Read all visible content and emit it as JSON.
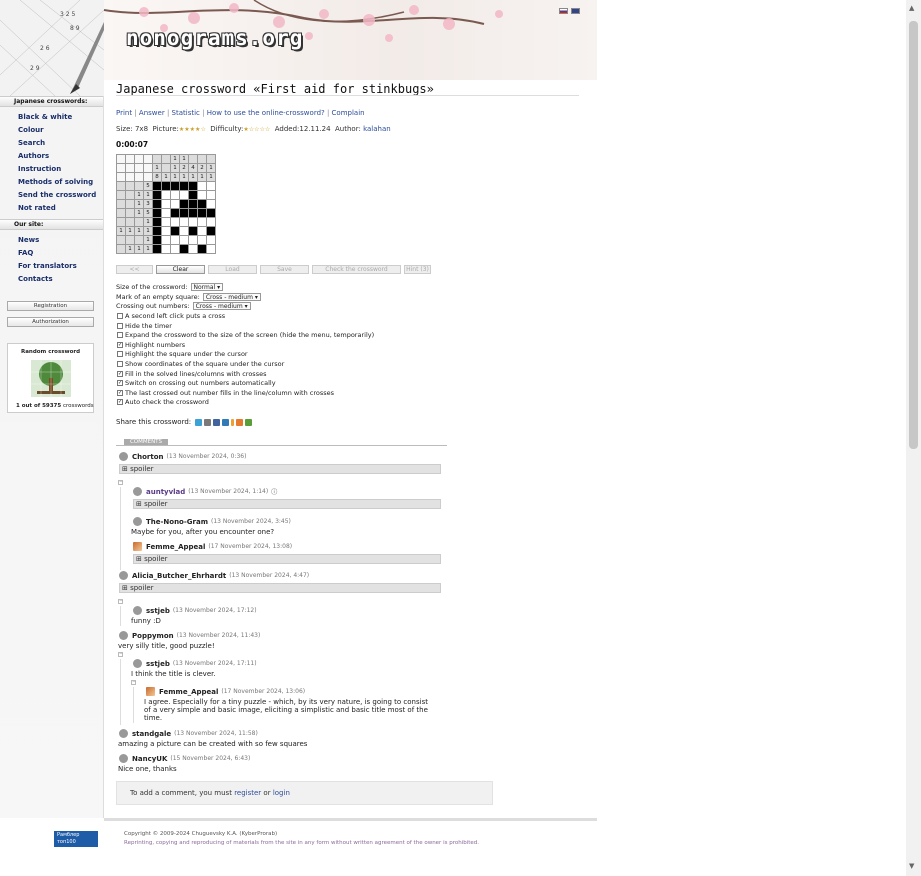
{
  "site": {
    "logo": "nonograms.org"
  },
  "sidebar": {
    "section1": "Japanese crosswords:",
    "items1": [
      "Black & white",
      "Colour",
      "Search",
      "Authors",
      "Instruction",
      "Methods of solving",
      "Send the crossword",
      "Not rated"
    ],
    "section2": "Our site:",
    "items2": [
      "News",
      "FAQ",
      "For translators",
      "Contacts"
    ],
    "registration": "Registration",
    "authorization": "Authorization",
    "random_title": "Random crossword",
    "random_count_a": "1 out of 59375",
    "random_count_b": "crosswords"
  },
  "puzzle": {
    "title": "Japanese crossword «First aid for stinkbugs»",
    "links": [
      "Print",
      "Answer",
      "Statistic",
      "How to use the online-crossword?",
      "Complain"
    ],
    "size_label": "Size:",
    "size": "7x8",
    "picture_label": "Picture:",
    "picture_stars": "★★★★☆",
    "difficulty_label": "Difficulty:",
    "difficulty_stars": "★☆☆☆☆",
    "added_label": "Added:",
    "added": "12.11.24",
    "author_label": "Author:",
    "author": "kalahan",
    "timer": "0:00:07",
    "col_clues": [
      [
        "",
        "1",
        "8"
      ],
      [
        "",
        "",
        "1"
      ],
      [
        "1",
        "1",
        "1"
      ],
      [
        "1",
        "2",
        "1"
      ],
      [
        "",
        "4",
        "1"
      ],
      [
        "",
        "2",
        "1"
      ],
      [
        "",
        "1",
        "1"
      ]
    ],
    "row_clues": [
      [
        "",
        "",
        "",
        "5"
      ],
      [
        "",
        "",
        "1",
        "1"
      ],
      [
        "",
        "",
        "1",
        "3"
      ],
      [
        "",
        "",
        "1",
        "5"
      ],
      [
        "",
        "",
        "",
        "1"
      ],
      [
        "1",
        "1",
        "1",
        "1"
      ],
      [
        "",
        "",
        "",
        "1"
      ],
      [
        "",
        "1",
        "1",
        "1"
      ]
    ],
    "cells": [
      [
        1,
        1,
        1,
        1,
        1,
        0,
        0
      ],
      [
        1,
        0,
        0,
        0,
        1,
        0,
        0
      ],
      [
        1,
        0,
        0,
        1,
        1,
        1,
        0
      ],
      [
        1,
        0,
        1,
        1,
        1,
        1,
        1
      ],
      [
        1,
        0,
        0,
        0,
        0,
        0,
        0
      ],
      [
        1,
        0,
        1,
        0,
        1,
        0,
        1
      ],
      [
        1,
        0,
        0,
        0,
        0,
        0,
        0
      ],
      [
        1,
        0,
        0,
        1,
        0,
        1,
        0
      ]
    ]
  },
  "buttons": {
    "undo": "<<",
    "clear": "Clear",
    "load": "Load",
    "save": "Save",
    "check": "Check the crossword",
    "hint": "Hint (3)"
  },
  "options": {
    "size_label": "Size of the crossword:",
    "size_value": "Normal",
    "mark_label": "Mark of an empty square:",
    "mark_value": "Cross - medium",
    "crossing_label": "Crossing out numbers:",
    "crossing_value": "Cross - medium",
    "checks": [
      {
        "label": "A second left click puts a cross",
        "checked": false
      },
      {
        "label": "Hide the timer",
        "checked": false
      },
      {
        "label": "Expand the crossword to the size of the screen (hide the menu, temporarily)",
        "checked": false
      },
      {
        "label": "Highlight numbers",
        "checked": true
      },
      {
        "label": "Highlight the square under the cursor",
        "checked": false
      },
      {
        "label": "Show coordinates of the square under the cursor",
        "checked": false
      },
      {
        "label": "Fill in the solved lines/columns with crosses",
        "checked": true
      },
      {
        "label": "Switch on crossing out numbers automatically",
        "checked": true
      },
      {
        "label": "The last crossed out number fills in the line/column with crosses",
        "checked": true
      },
      {
        "label": "Auto check the crossword",
        "checked": true
      }
    ],
    "share_label": "Share this crossword:"
  },
  "comments": {
    "tab": "COMMENTS",
    "spoiler": "⊞ spoiler",
    "list": [
      {
        "author": "Chorton",
        "date": "(13 November 2024, 0:36)"
      },
      {
        "author": "auntyvlad",
        "date": "(13 November 2024, 1:14)"
      },
      {
        "author": "The-Nono-Gram",
        "date": "(13 November 2024, 3:45)",
        "text": "Maybe for you, after you encounter one?"
      },
      {
        "author": "Femme_Appeal",
        "date": "(17 November 2024, 13:08)"
      },
      {
        "author": "Alicia_Butcher_Ehrhardt",
        "date": "(13 November 2024, 4:47)"
      },
      {
        "author": "sstjeb",
        "date": "(13 November 2024, 17:12)",
        "text": "funny :D"
      },
      {
        "author": "Poppymon",
        "date": "(13 November 2024, 11:43)",
        "text": "very silly title, good puzzle!"
      },
      {
        "author": "sstjeb",
        "date": "(13 November 2024, 17:11)",
        "text": "I think the title is clever."
      },
      {
        "author": "Femme_Appeal",
        "date": "(17 November 2024, 13:06)",
        "text": "I agree. Especially for a tiny puzzle - which, by its very nature, is going to consist of a very simple and basic image, eliciting a simplistic and basic title most of the time."
      },
      {
        "author": "standgale",
        "date": "(13 November 2024, 11:58)",
        "text": "amazing a picture can be created with so few squares"
      },
      {
        "author": "NancyUK",
        "date": "(15 November 2024, 6:43)",
        "text": "Nice one, thanks"
      }
    ],
    "add_prefix": "To add a comment, you must",
    "register": "register",
    "or": "or",
    "login": "login"
  },
  "footer": {
    "copyright": "Copyright © 2009-2024 Chuguevsky K.A. (KyberProrab)",
    "rights": "Reprinting, copying and reproducing of materials from the site in any form without written agreement of the owner is prohibited.",
    "counter": "Рамблер\nтоп100"
  }
}
